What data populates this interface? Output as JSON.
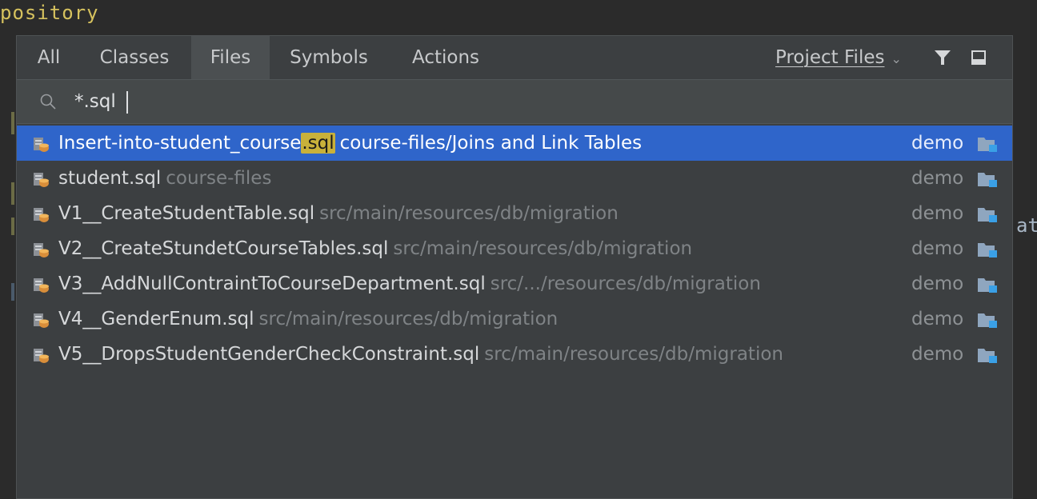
{
  "editor": {
    "top_text": "pository",
    "right_fragment": "at"
  },
  "tabs": [
    {
      "label": "All",
      "selected": false
    },
    {
      "label": "Classes",
      "selected": false
    },
    {
      "label": "Files",
      "selected": true
    },
    {
      "label": "Symbols",
      "selected": false
    },
    {
      "label": "Actions",
      "selected": false
    }
  ],
  "scope": {
    "label": "Project Files",
    "mnemonic": "P"
  },
  "toolbar_icons": [
    "filter-icon",
    "pin-icon"
  ],
  "search": {
    "value": "*.sql"
  },
  "results": [
    {
      "name_prefix": "Insert-into-student_course",
      "name_match": ".sql",
      "path": "course-files/Joins and Link Tables",
      "module": "demo",
      "selected": true
    },
    {
      "name_prefix": "student",
      "name_match": ".sql",
      "path": "course-files",
      "module": "demo",
      "selected": false
    },
    {
      "name_prefix": "V1__CreateStudentTable",
      "name_match": ".sql",
      "path": "src/main/resources/db/migration",
      "module": "demo",
      "selected": false
    },
    {
      "name_prefix": "V2__CreateStundetCourseTables",
      "name_match": ".sql",
      "path": "src/main/resources/db/migration",
      "module": "demo",
      "selected": false
    },
    {
      "name_prefix": "V3__AddNullContraintToCourseDepartment",
      "name_match": ".sql",
      "path": "src/.../resources/db/migration",
      "module": "demo",
      "selected": false
    },
    {
      "name_prefix": "V4__GenderEnum",
      "name_match": ".sql",
      "path": "src/main/resources/db/migration",
      "module": "demo",
      "selected": false
    },
    {
      "name_prefix": "V5__DropsStudentGenderCheckConstraint",
      "name_match": ".sql",
      "path": "src/main/resources/db/migration",
      "module": "demo",
      "selected": false
    }
  ],
  "colors": {
    "popup_bg": "#3c3f41",
    "selection": "#2f65ca",
    "match_highlight": "#c9b13a",
    "path_gray": "#7f8386"
  }
}
